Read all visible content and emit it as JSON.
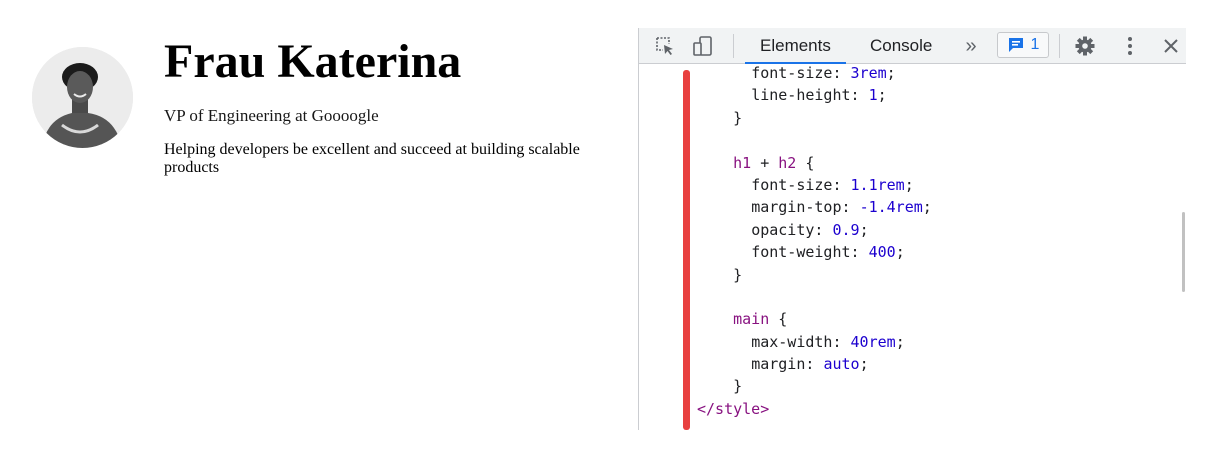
{
  "profile": {
    "avatar_alt": "profile photo",
    "name": "Frau Katerina",
    "role": "VP of Engineering at Goooogle",
    "bio": "Helping developers be excellent and succeed at building scalable products"
  },
  "devtools": {
    "toolbar": {
      "inspect_icon": "inspect-element-icon",
      "device_icon": "device-toolbar-icon",
      "tabs": [
        {
          "label": "Elements",
          "active": true
        },
        {
          "label": "Console",
          "active": false
        }
      ],
      "more_tabs": "»",
      "issues_count": "1",
      "settings_icon": "gear-icon",
      "menu_icon": "kebab-menu-icon",
      "close_icon": "close-icon"
    },
    "code": {
      "l1": {
        "prop": "font-size",
        "val": "3rem"
      },
      "l2": {
        "prop": "line-height",
        "val": "1"
      },
      "l3": {
        "text": "}"
      },
      "l5": {
        "sel_a": "h1",
        "op": " + ",
        "sel_b": "h2",
        "brace": " {"
      },
      "l6": {
        "prop": "font-size",
        "val": "1.1rem"
      },
      "l7": {
        "prop": "margin-top",
        "val": "-1.4rem"
      },
      "l8": {
        "prop": "opacity",
        "val": "0.9"
      },
      "l9": {
        "prop": "font-weight",
        "val": "400"
      },
      "l10": {
        "text": "}"
      },
      "l12": {
        "sel": "main",
        "brace": " {"
      },
      "l13": {
        "prop": "max-width",
        "val": "40rem"
      },
      "l14": {
        "prop": "margin",
        "val": "auto"
      },
      "l15": {
        "text": "}"
      },
      "l16": {
        "text": "</style>"
      }
    }
  },
  "colors": {
    "active_tab": "#1a73e8",
    "change_bar": "#e8403f",
    "selector": "#881280",
    "value": "#1c00cf"
  }
}
